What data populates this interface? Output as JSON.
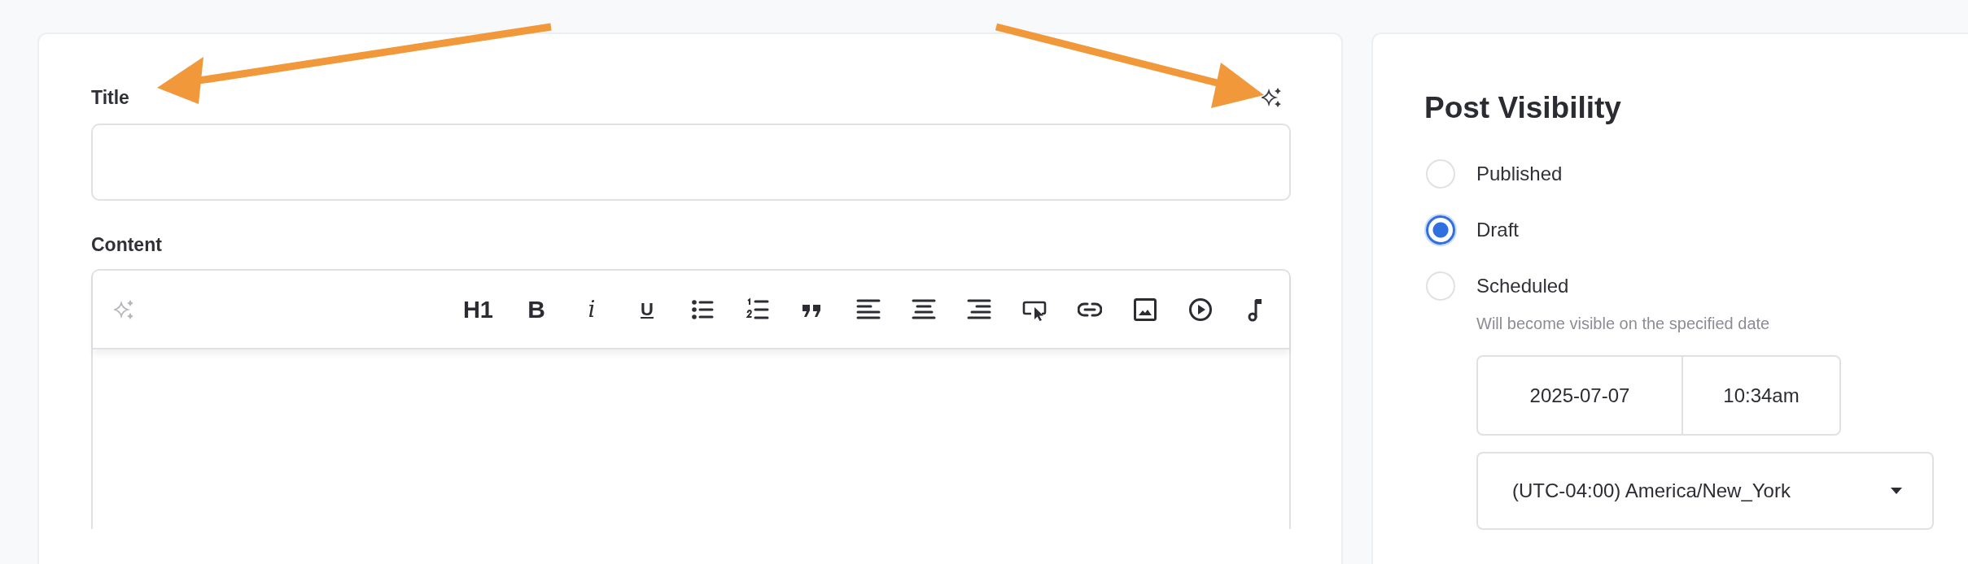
{
  "title_field": {
    "label": "Title"
  },
  "content_editor": {
    "label": "Content",
    "toolbar": [
      {
        "kind": "sparkle"
      },
      {
        "kind": "heading",
        "label": "H1"
      },
      {
        "kind": "bold",
        "label": "B"
      },
      {
        "kind": "italic",
        "label": "i"
      },
      {
        "kind": "underline",
        "label": "U"
      },
      {
        "kind": "bullet-list"
      },
      {
        "kind": "numbered-list"
      },
      {
        "kind": "quote"
      },
      {
        "kind": "align-left"
      },
      {
        "kind": "align-center"
      },
      {
        "kind": "align-right"
      },
      {
        "kind": "button"
      },
      {
        "kind": "link"
      },
      {
        "kind": "image"
      },
      {
        "kind": "video"
      },
      {
        "kind": "audio"
      }
    ]
  },
  "post_visibility": {
    "heading": "Post Visibility",
    "options": [
      {
        "label": "Published",
        "selected": false
      },
      {
        "label": "Draft",
        "selected": true
      },
      {
        "label": "Scheduled",
        "selected": false,
        "hint": "Will become visible on the specified date"
      }
    ],
    "date": "2025-07-07",
    "time": "10:34am",
    "timezone": "(UTC-04:00) America/New_York"
  }
}
